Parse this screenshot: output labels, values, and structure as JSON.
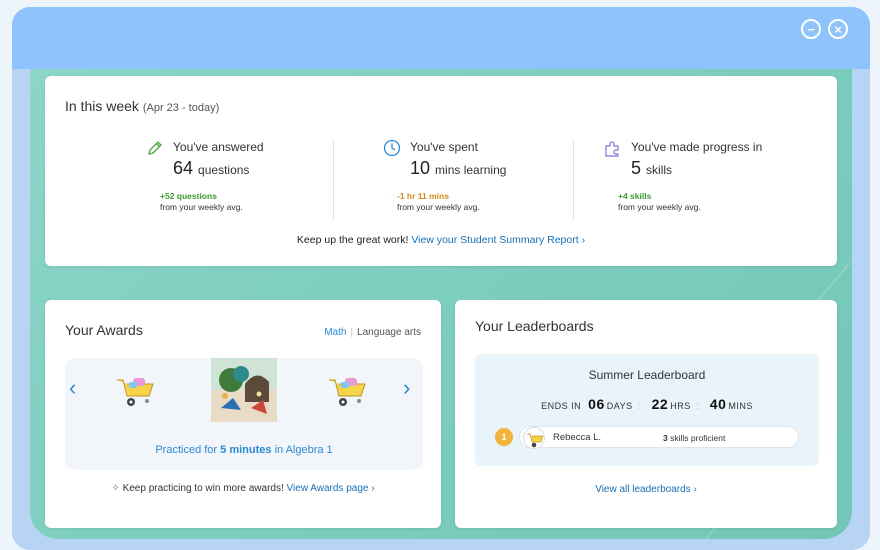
{
  "window": {
    "minimize_label": "−",
    "close_label": "×"
  },
  "week": {
    "title": "In this week",
    "range": "(Apr 23 - today)",
    "stats": [
      {
        "label": "You've answered",
        "value": "64",
        "unit": "questions",
        "delta": "+52 questions",
        "delta_color": "#3b9a2f",
        "from": "from your weekly avg."
      },
      {
        "label": "You've spent",
        "value": "10",
        "unit": "mins learning",
        "delta": "-1 hr 11 mins",
        "delta_color": "#d68a1a",
        "from": "from your weekly avg."
      },
      {
        "label": "You've made progress in",
        "value": "5",
        "unit": "skills",
        "delta": "+4 skills",
        "delta_color": "#3b9a2f",
        "from": "from your weekly avg."
      }
    ],
    "footer_text": "Keep up the great work!",
    "footer_link": "View your Student Summary Report"
  },
  "awards": {
    "title": "Your Awards",
    "tab_math": "Math",
    "tab_separator": "|",
    "tab_language": "Language arts",
    "caption_prefix": "Practiced for",
    "caption_value": "5 minutes",
    "caption_suffix": "in Algebra 1",
    "footer_text": "Keep practicing to win more awards!",
    "footer_link": "View Awards page",
    "arrow_left": "‹",
    "arrow_right": "›"
  },
  "leaderboards": {
    "title": "Your Leaderboards",
    "board_name": "Summer Leaderboard",
    "ends_label": "ENDS IN",
    "days": "06",
    "days_label": "DAYS",
    "hrs": "22",
    "hrs_label": "HRS",
    "mins": "40",
    "mins_label": "MINS",
    "rank": "1",
    "user": "Rebecca L.",
    "skills_count": "3",
    "skills_label": "skills proficient",
    "footer_link": "View all leaderboards"
  },
  "colors": {
    "accent": "#2b8ad4",
    "link": "#1a6fb3",
    "titlebar": "#8fc3fb",
    "stage": "#7fcfc0"
  }
}
